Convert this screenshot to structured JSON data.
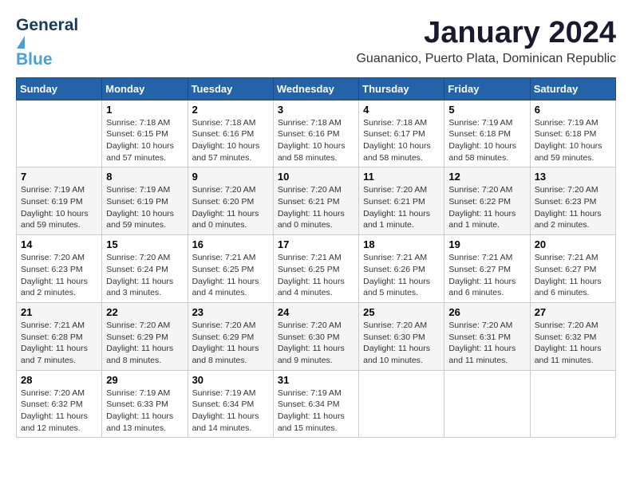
{
  "header": {
    "logo_general": "General",
    "logo_blue": "Blue",
    "month_title": "January 2024",
    "subtitle": "Guananico, Puerto Plata, Dominican Republic"
  },
  "days_of_week": [
    "Sunday",
    "Monday",
    "Tuesday",
    "Wednesday",
    "Thursday",
    "Friday",
    "Saturday"
  ],
  "weeks": [
    [
      {
        "day": "",
        "info": ""
      },
      {
        "day": "1",
        "info": "Sunrise: 7:18 AM\nSunset: 6:15 PM\nDaylight: 10 hours\nand 57 minutes."
      },
      {
        "day": "2",
        "info": "Sunrise: 7:18 AM\nSunset: 6:16 PM\nDaylight: 10 hours\nand 57 minutes."
      },
      {
        "day": "3",
        "info": "Sunrise: 7:18 AM\nSunset: 6:16 PM\nDaylight: 10 hours\nand 58 minutes."
      },
      {
        "day": "4",
        "info": "Sunrise: 7:18 AM\nSunset: 6:17 PM\nDaylight: 10 hours\nand 58 minutes."
      },
      {
        "day": "5",
        "info": "Sunrise: 7:19 AM\nSunset: 6:18 PM\nDaylight: 10 hours\nand 58 minutes."
      },
      {
        "day": "6",
        "info": "Sunrise: 7:19 AM\nSunset: 6:18 PM\nDaylight: 10 hours\nand 59 minutes."
      }
    ],
    [
      {
        "day": "7",
        "info": "Sunrise: 7:19 AM\nSunset: 6:19 PM\nDaylight: 10 hours\nand 59 minutes."
      },
      {
        "day": "8",
        "info": "Sunrise: 7:19 AM\nSunset: 6:19 PM\nDaylight: 10 hours\nand 59 minutes."
      },
      {
        "day": "9",
        "info": "Sunrise: 7:20 AM\nSunset: 6:20 PM\nDaylight: 11 hours\nand 0 minutes."
      },
      {
        "day": "10",
        "info": "Sunrise: 7:20 AM\nSunset: 6:21 PM\nDaylight: 11 hours\nand 0 minutes."
      },
      {
        "day": "11",
        "info": "Sunrise: 7:20 AM\nSunset: 6:21 PM\nDaylight: 11 hours\nand 1 minute."
      },
      {
        "day": "12",
        "info": "Sunrise: 7:20 AM\nSunset: 6:22 PM\nDaylight: 11 hours\nand 1 minute."
      },
      {
        "day": "13",
        "info": "Sunrise: 7:20 AM\nSunset: 6:23 PM\nDaylight: 11 hours\nand 2 minutes."
      }
    ],
    [
      {
        "day": "14",
        "info": "Sunrise: 7:20 AM\nSunset: 6:23 PM\nDaylight: 11 hours\nand 2 minutes."
      },
      {
        "day": "15",
        "info": "Sunrise: 7:20 AM\nSunset: 6:24 PM\nDaylight: 11 hours\nand 3 minutes."
      },
      {
        "day": "16",
        "info": "Sunrise: 7:21 AM\nSunset: 6:25 PM\nDaylight: 11 hours\nand 4 minutes."
      },
      {
        "day": "17",
        "info": "Sunrise: 7:21 AM\nSunset: 6:25 PM\nDaylight: 11 hours\nand 4 minutes."
      },
      {
        "day": "18",
        "info": "Sunrise: 7:21 AM\nSunset: 6:26 PM\nDaylight: 11 hours\nand 5 minutes."
      },
      {
        "day": "19",
        "info": "Sunrise: 7:21 AM\nSunset: 6:27 PM\nDaylight: 11 hours\nand 6 minutes."
      },
      {
        "day": "20",
        "info": "Sunrise: 7:21 AM\nSunset: 6:27 PM\nDaylight: 11 hours\nand 6 minutes."
      }
    ],
    [
      {
        "day": "21",
        "info": "Sunrise: 7:21 AM\nSunset: 6:28 PM\nDaylight: 11 hours\nand 7 minutes."
      },
      {
        "day": "22",
        "info": "Sunrise: 7:20 AM\nSunset: 6:29 PM\nDaylight: 11 hours\nand 8 minutes."
      },
      {
        "day": "23",
        "info": "Sunrise: 7:20 AM\nSunset: 6:29 PM\nDaylight: 11 hours\nand 8 minutes."
      },
      {
        "day": "24",
        "info": "Sunrise: 7:20 AM\nSunset: 6:30 PM\nDaylight: 11 hours\nand 9 minutes."
      },
      {
        "day": "25",
        "info": "Sunrise: 7:20 AM\nSunset: 6:30 PM\nDaylight: 11 hours\nand 10 minutes."
      },
      {
        "day": "26",
        "info": "Sunrise: 7:20 AM\nSunset: 6:31 PM\nDaylight: 11 hours\nand 11 minutes."
      },
      {
        "day": "27",
        "info": "Sunrise: 7:20 AM\nSunset: 6:32 PM\nDaylight: 11 hours\nand 11 minutes."
      }
    ],
    [
      {
        "day": "28",
        "info": "Sunrise: 7:20 AM\nSunset: 6:32 PM\nDaylight: 11 hours\nand 12 minutes."
      },
      {
        "day": "29",
        "info": "Sunrise: 7:19 AM\nSunset: 6:33 PM\nDaylight: 11 hours\nand 13 minutes."
      },
      {
        "day": "30",
        "info": "Sunrise: 7:19 AM\nSunset: 6:34 PM\nDaylight: 11 hours\nand 14 minutes."
      },
      {
        "day": "31",
        "info": "Sunrise: 7:19 AM\nSunset: 6:34 PM\nDaylight: 11 hours\nand 15 minutes."
      },
      {
        "day": "",
        "info": ""
      },
      {
        "day": "",
        "info": ""
      },
      {
        "day": "",
        "info": ""
      }
    ]
  ]
}
